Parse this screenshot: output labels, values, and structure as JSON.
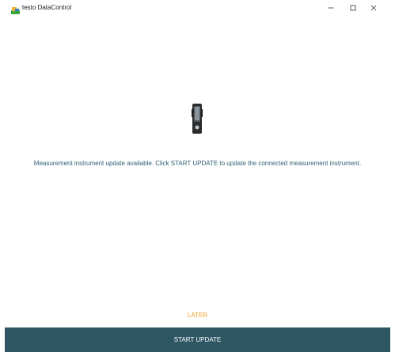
{
  "window": {
    "title": "testo DataControl",
    "icon": "testo-app-icon",
    "controls": {
      "minimize_icon": "minimize-icon",
      "maximize_icon": "maximize-icon",
      "close_icon": "close-icon"
    }
  },
  "main": {
    "device_icon": "handheld-instrument-icon",
    "message": "Measurement instrument update available. Click START UPDATE to update the connected measurement instrument."
  },
  "actions": {
    "later_label": "LATER",
    "start_update_label": "START UPDATE"
  },
  "colors": {
    "accent_orange": "#f39a21",
    "primary_button_bg": "#2e5663",
    "message_text": "#2f5f73"
  }
}
